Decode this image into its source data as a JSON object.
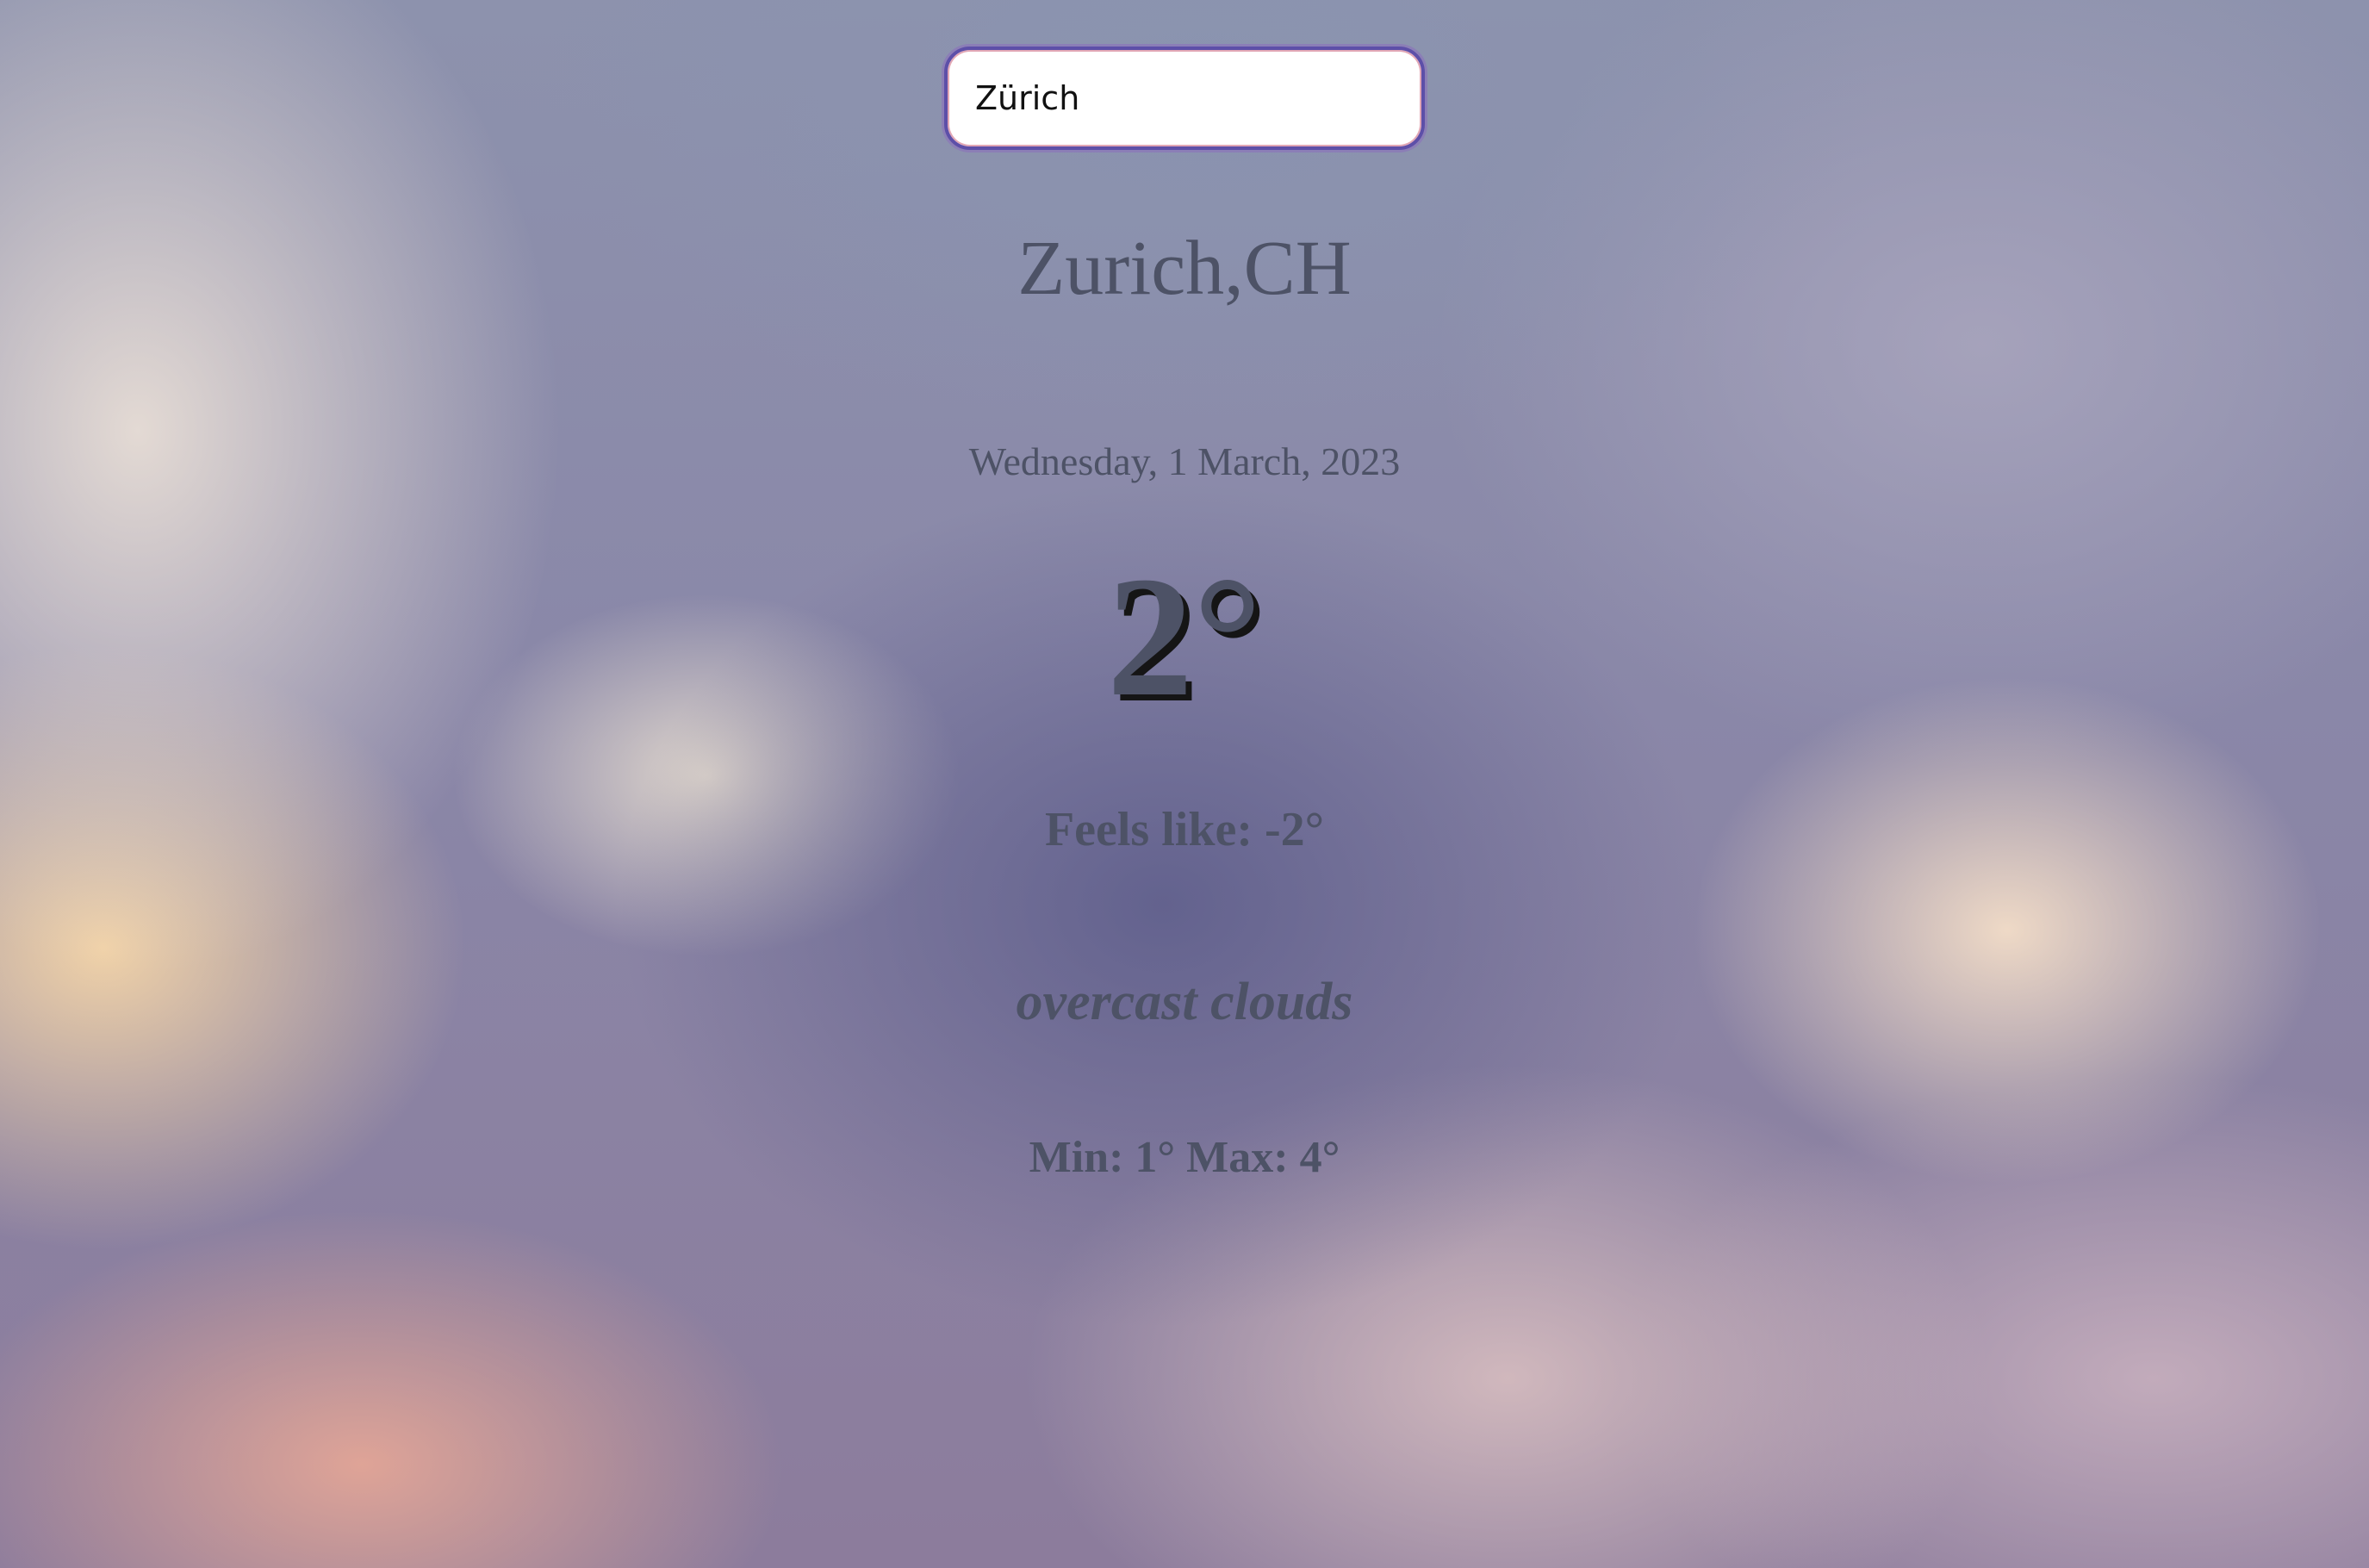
{
  "search": {
    "value": "Zürich",
    "placeholder": ""
  },
  "weather": {
    "location": "Zurich,CH",
    "date": "Wednesday, 1 March, 2023",
    "temperature": "2°",
    "feels_like": "Feels like: -2°",
    "description": "overcast clouds",
    "min_max": "Min: 1° Max: 4°"
  },
  "colors": {
    "text": "#4d5266",
    "temperature_shadow": "#151515",
    "input_border": "#5d4fa8"
  }
}
